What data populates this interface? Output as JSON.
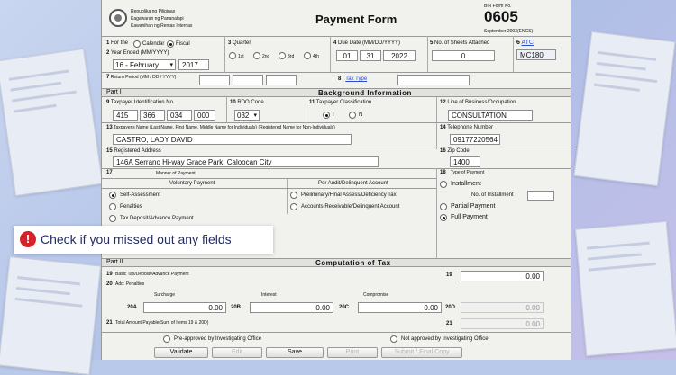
{
  "header": {
    "agency_lines": [
      "Republika ng Pilipinas",
      "Kagawaran ng Pananalapi",
      "Kawanihan ng Rentas Internas"
    ],
    "title": "Payment Form",
    "bir_form_label": "BIR Form No.",
    "form_no": "0605",
    "form_date": "September 2003(ENCS)"
  },
  "items": {
    "i1": {
      "num": "1",
      "label": "For the",
      "opt1": "Calendar",
      "opt2": "Fiscal"
    },
    "i2": {
      "num": "2",
      "label": "Year Ended (MM/YYYY)",
      "month": "16 - February",
      "year": "2017"
    },
    "i3": {
      "num": "3",
      "label": "Quarter",
      "q1": "1st",
      "q2": "2nd",
      "q3": "3rd",
      "q4": "4th"
    },
    "i4": {
      "num": "4",
      "label": "Due Date (MM/DD/YYYY)",
      "mm": "01",
      "dd": "31",
      "yyyy": "2022"
    },
    "i5": {
      "num": "5",
      "label": "No. of Sheets Attached",
      "value": "0"
    },
    "i6": {
      "num": "6",
      "label": "ATC",
      "value": "MC180"
    },
    "i7": {
      "num": "7",
      "label": "Return Period (MM / DD / YYYY)"
    },
    "i8": {
      "num": "8",
      "label": "Tax Type"
    }
  },
  "part1": {
    "label": "Part I",
    "title": "Background Information",
    "i9": {
      "num": "9",
      "label": "Taxpayer Identification No.",
      "tin": [
        "415",
        "366",
        "034",
        "000"
      ]
    },
    "i10": {
      "num": "10",
      "label": "RDO Code",
      "value": "032"
    },
    "i11": {
      "num": "11",
      "label": "Taxpayer Classification",
      "opt1": "I",
      "opt2": "N"
    },
    "i12": {
      "num": "12",
      "label": "Line of Business/Occupation",
      "value": "CONSULTATION"
    },
    "i13": {
      "num": "13",
      "label": "Taxpayer's Name (Last Name, First Name, Middle Name for Individuals) (Registered Name for Non-Individuals)",
      "value": "CASTRO, LADY DAVID"
    },
    "i14": {
      "num": "14",
      "label": "Telephone Number",
      "value": "09177220564"
    },
    "i15": {
      "num": "15",
      "label": "Registered Address",
      "value": "146A Serrano Hi-way Grace Park, Caloocan City"
    },
    "i16": {
      "num": "16",
      "label": "Zip Code",
      "value": "1400"
    },
    "i17": {
      "num": "17",
      "label": "Manner of Payment"
    },
    "i18": {
      "num": "18",
      "label": "Type of Payment",
      "installment": "Installment",
      "no_installment": "No. of Installment",
      "partial": "Partial Payment",
      "full": "Full Payment"
    },
    "voluntary_title": "Voluntary Payment",
    "audit_title": "Per Audit/Delinquent Account",
    "manner_opts": [
      "Self-Assessment",
      "Penalties",
      "Tax Deposit/Advance Payment"
    ],
    "audit_opts": [
      "Preliminary/Final Assess/Deficiency Tax",
      "Accounts Receivable/Delinquent Account"
    ]
  },
  "notice": {
    "text": "Check if you missed out any fields",
    "icon": "exclamation-icon",
    "color": "#d5232a"
  },
  "part2": {
    "label": "Part II",
    "title": "Computation of Tax",
    "i19": {
      "num": "19",
      "label": "Basic Tax/Deposit/Advance Payment",
      "value": "0.00"
    },
    "i20": {
      "num": "20",
      "label": "Add: Penalties"
    },
    "col_surcharge": "Surcharge",
    "col_interest": "Interest",
    "col_compromise": "Compromise",
    "r20a": {
      "label": "20A",
      "value": "0.00"
    },
    "r20b": {
      "label": "20B",
      "value": "0.00"
    },
    "r20c": {
      "label": "20C",
      "value": "0.00"
    },
    "r20d": {
      "label": "20D",
      "value": "0.00"
    },
    "i21": {
      "num": "21",
      "label": "Total Amount Payable(Sum of Items 19 & 20D)",
      "value": "0.00"
    }
  },
  "approval": {
    "opt1": "Pre-approved by Investigating Office",
    "opt2": "Not approved by Investigating Office"
  },
  "buttons": {
    "validate": "Validate",
    "edit": "Edit",
    "save": "Save",
    "print": "Print",
    "submit": "Submit / Final Copy"
  }
}
